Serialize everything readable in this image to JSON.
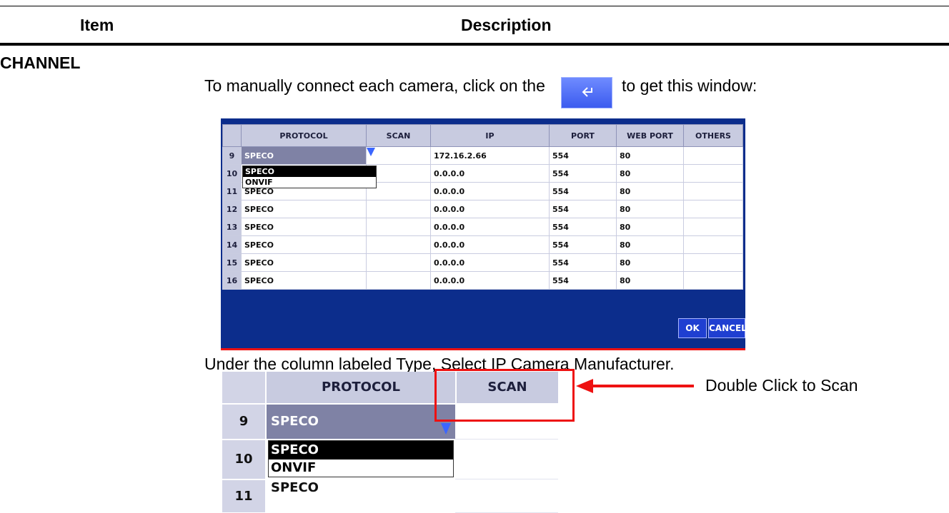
{
  "header": {
    "item": "Item",
    "description": "Description"
  },
  "section": "CHANNEL",
  "intro": {
    "before": "To manually connect each camera, click on the",
    "after": "to get this window:"
  },
  "enter_icon": "enter-return-icon",
  "dialog": {
    "columns": [
      "",
      "PROTOCOL",
      "SCAN",
      "IP",
      "PORT",
      "WEB PORT",
      "OTHERS"
    ],
    "rows": [
      {
        "num": "9",
        "protocol": "SPECO",
        "scan": "",
        "ip": "172.16.2.66",
        "port": "554",
        "web_port": "80",
        "others": ""
      },
      {
        "num": "10",
        "protocol": "",
        "scan": "",
        "ip": "0.0.0.0",
        "port": "554",
        "web_port": "80",
        "others": ""
      },
      {
        "num": "11",
        "protocol": "SPECO",
        "scan": "",
        "ip": "0.0.0.0",
        "port": "554",
        "web_port": "80",
        "others": ""
      },
      {
        "num": "12",
        "protocol": "SPECO",
        "scan": "",
        "ip": "0.0.0.0",
        "port": "554",
        "web_port": "80",
        "others": ""
      },
      {
        "num": "13",
        "protocol": "SPECO",
        "scan": "",
        "ip": "0.0.0.0",
        "port": "554",
        "web_port": "80",
        "others": ""
      },
      {
        "num": "14",
        "protocol": "SPECO",
        "scan": "",
        "ip": "0.0.0.0",
        "port": "554",
        "web_port": "80",
        "others": ""
      },
      {
        "num": "15",
        "protocol": "SPECO",
        "scan": "",
        "ip": "0.0.0.0",
        "port": "554",
        "web_port": "80",
        "others": ""
      },
      {
        "num": "16",
        "protocol": "SPECO",
        "scan": "",
        "ip": "0.0.0.0",
        "port": "554",
        "web_port": "80",
        "others": ""
      }
    ],
    "dropdown_options": [
      "SPECO",
      "ONVIF"
    ],
    "selected_option": "SPECO",
    "ok": "OK",
    "cancel": "CANCEL"
  },
  "caption": "Under the column labeled Type, Select IP Camera Manufacturer.",
  "zoom": {
    "protocol_header": "PROTOCOL",
    "scan_header": "SCAN",
    "rows": [
      "9",
      "10",
      "11"
    ],
    "row9_protocol": "SPECO",
    "row11_protocol": "SPECO",
    "options": [
      "SPECO",
      "ONVIF"
    ]
  },
  "annotation": "Double Click to Scan",
  "colors": {
    "dialog_bg": "#0c2d8c",
    "header_bg": "#c8cbe0",
    "highlight": "#ee1111",
    "button": "#1f3fd1"
  }
}
